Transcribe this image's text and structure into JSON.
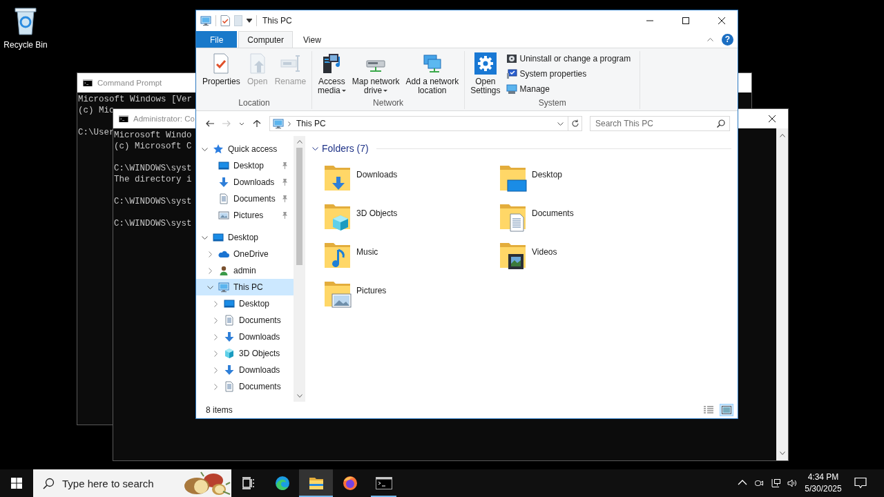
{
  "desktop_icons": [
    {
      "label": "Recycle Bin"
    }
  ],
  "console_windows": [
    {
      "title": "Command Prompt",
      "blocks": [
        [
          "Microsoft Windows [Ver",
          "(c) Mic"
        ],
        [
          "C:\\User"
        ]
      ]
    },
    {
      "title": "Administrator: Co",
      "blocks": [
        [
          "Microsoft Windo",
          "(c) Microsoft C"
        ],
        [
          "C:\\WINDOWS\\syst",
          "The directory i"
        ],
        [
          "C:\\WINDOWS\\syst"
        ],
        [
          "C:\\WINDOWS\\syst"
        ]
      ]
    }
  ],
  "explorer": {
    "title": "This PC",
    "help": "?",
    "tabs": [
      {
        "label": "File",
        "kind": "file",
        "selected": false
      },
      {
        "label": "Computer",
        "kind": "tab",
        "selected": true
      },
      {
        "label": "View",
        "kind": "tab",
        "selected": false
      }
    ],
    "ribbon_groups": [
      {
        "label": "Location",
        "buttons": [
          {
            "label": "Properties",
            "kind": "properties",
            "disabled": false,
            "dropdown": false
          },
          {
            "label": "Open",
            "kind": "open",
            "disabled": true,
            "dropdown": false
          },
          {
            "label": "Rename",
            "kind": "rename",
            "disabled": true,
            "dropdown": false
          }
        ]
      },
      {
        "label": "Network",
        "buttons": [
          {
            "label": "Access\nmedia",
            "kind": "media",
            "disabled": false,
            "dropdown": true
          },
          {
            "label": "Map network\ndrive",
            "kind": "drive",
            "disabled": false,
            "dropdown": true
          },
          {
            "label": "Add a network\nlocation",
            "kind": "location",
            "disabled": false,
            "dropdown": false
          }
        ]
      },
      {
        "label": "System",
        "buttons": [
          {
            "label": "Open\nSettings",
            "kind": "settings",
            "disabled": false,
            "dropdown": false
          }
        ],
        "small_buttons": [
          {
            "label": "Uninstall or change a program",
            "kind": "uninstall"
          },
          {
            "label": "System properties",
            "kind": "sysprops"
          },
          {
            "label": "Manage",
            "kind": "manage"
          }
        ]
      }
    ],
    "history": {
      "back_disabled": false,
      "forward_disabled": true
    },
    "address": {
      "location": "This PC"
    },
    "search": {
      "placeholder": "Search This PC"
    },
    "navigation": [
      {
        "label": "Quick access",
        "kind": "star",
        "expanded": true,
        "selected": false,
        "children": [
          {
            "label": "Desktop",
            "kind": "desktop",
            "pinned": true,
            "selected": false
          },
          {
            "label": "Downloads",
            "kind": "downloads",
            "pinned": true,
            "selected": false
          },
          {
            "label": "Documents",
            "kind": "documents",
            "pinned": true,
            "selected": false
          },
          {
            "label": "Pictures",
            "kind": "pictures",
            "pinned": true,
            "selected": false
          }
        ]
      },
      {
        "label": "Desktop",
        "kind": "desktop",
        "expanded": true,
        "selected": false,
        "children": [
          {
            "label": "OneDrive",
            "kind": "cloud",
            "expanded": false,
            "selected": false
          },
          {
            "label": "admin",
            "kind": "user",
            "expanded": false,
            "selected": false
          },
          {
            "label": "This PC",
            "kind": "pc",
            "expanded": true,
            "selected": true,
            "children": [
              {
                "label": "Desktop",
                "kind": "desktop",
                "expanded": false,
                "selected": false
              },
              {
                "label": "Documents",
                "kind": "documents",
                "expanded": false,
                "selected": false
              },
              {
                "label": "Downloads",
                "kind": "downloads",
                "expanded": false,
                "selected": false
              },
              {
                "label": "3D Objects",
                "kind": "objects3d",
                "expanded": false,
                "selected": false
              },
              {
                "label": "Downloads",
                "kind": "downloads",
                "expanded": false,
                "selected": false
              },
              {
                "label": "Documents",
                "kind": "documents",
                "expanded": false,
                "selected": false
              }
            ]
          }
        ]
      }
    ],
    "section": {
      "title": "Folders (7)",
      "expanded": true
    },
    "folders": [
      {
        "label": "Downloads",
        "kind": "downloads"
      },
      {
        "label": "Desktop",
        "kind": "desktop"
      },
      {
        "label": "3D Objects",
        "kind": "objects3d"
      },
      {
        "label": "Documents",
        "kind": "documents"
      },
      {
        "label": "Music",
        "kind": "music"
      },
      {
        "label": "Videos",
        "kind": "videos"
      },
      {
        "label": "Pictures",
        "kind": "pictures"
      }
    ],
    "status": "8 items"
  },
  "taskbar": {
    "search": {
      "placeholder": "Type here to search"
    },
    "apps": [
      {
        "kind": "edge",
        "running": false,
        "active": false
      },
      {
        "kind": "explorer",
        "running": true,
        "active": true
      },
      {
        "kind": "firefox",
        "running": false,
        "active": false
      },
      {
        "kind": "terminal",
        "running": true,
        "active": false
      }
    ],
    "clock": {
      "time": "4:34 PM",
      "date": "5/30/2025"
    }
  }
}
